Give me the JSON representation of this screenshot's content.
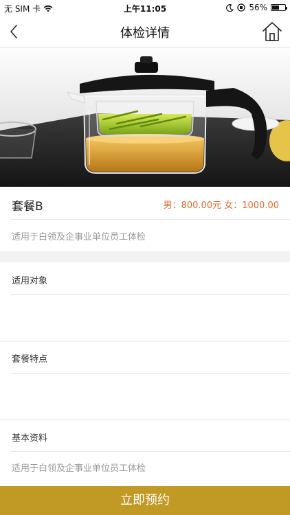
{
  "status_bar": {
    "carrier": "无 SIM 卡",
    "time": "上午11:05",
    "battery_percent_label": "56%",
    "battery_level": 0.56
  },
  "nav": {
    "title": "体检详情"
  },
  "package": {
    "name": "套餐B",
    "price": "男：800.00元 女：1000.00",
    "description": "适用于白领及企事业单位员工体检"
  },
  "sections": {
    "applicable_title": "适用对象",
    "features_title": "套餐特点",
    "basic_info_title": "基本资料",
    "basic_info_text": "适用于白领及企事业单位员工体检"
  },
  "actions": {
    "book_label": "立即预约"
  },
  "colors": {
    "accent_button": "#c19a25",
    "price_text": "#e66a2c",
    "muted_text": "#999999",
    "divider": "#e5e5e5",
    "section_gap": "#f2f2f2"
  }
}
